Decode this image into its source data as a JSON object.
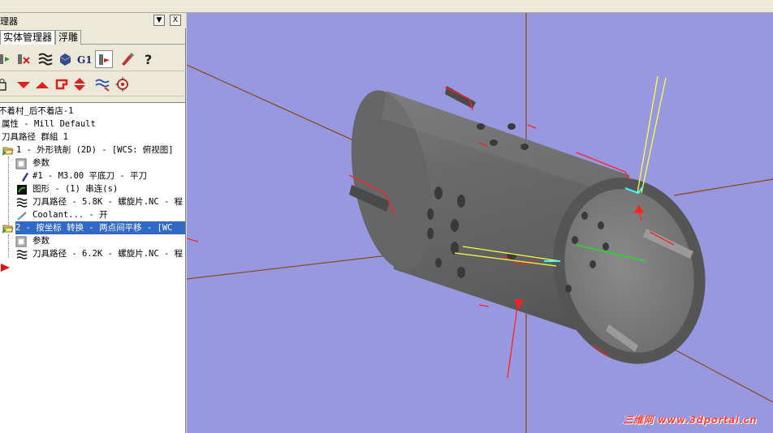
{
  "window": {
    "panel_title": "理器",
    "pin_label": "▼",
    "close_label": "X"
  },
  "tabs": [
    {
      "label": "实体管理器",
      "active": true
    },
    {
      "label": "浮雕",
      "active": false
    }
  ],
  "toolbar": {
    "row1": [
      "select-all-icon",
      "deselect-icon",
      "toolpath-regen-icon",
      "backplot-icon",
      "g1-icon",
      "post-icon",
      "highfeed-icon",
      "help-icon"
    ],
    "g1_label": "G1",
    "help_label": "?",
    "row2": [
      "lock-icon",
      "move-down-icon",
      "move-up-icon",
      "insert-arrow-icon",
      "up-down-icon",
      "wave-icon",
      "target-icon"
    ]
  },
  "tree": {
    "machine": "不着村_后不着店-1",
    "properties": "属性 - Mill Default",
    "group": "刀具路径 群組 1",
    "op1": {
      "title": "1 - 外形铣削 (2D) - [WCS: 俯视图]",
      "params": "参数",
      "tool": "#1 - M3.00 平底刀 - 平刀",
      "geometry": "图形 - (1) 串连(s)",
      "toolpath": "刀具路径 - 5.8K - 螺旋片.NC - 程",
      "coolant": "Coolant... - 开"
    },
    "op2": {
      "title": "2 - 按坐标 转换 - 两点间平移 - [WC",
      "params": "参数",
      "toolpath": "刀具路径 - 6.2K - 螺旋片.NC - 程"
    }
  },
  "viewport": {
    "background": "#9898e0",
    "watermark": "三维网 www.3dportal.cn"
  },
  "colors": {
    "selection": "#3169c6",
    "axis": "#8b4513",
    "cut": "#ff2020",
    "tool_yellow": "#ffff40",
    "tool_green": "#30d030",
    "tool_cyan": "#40ffff"
  }
}
